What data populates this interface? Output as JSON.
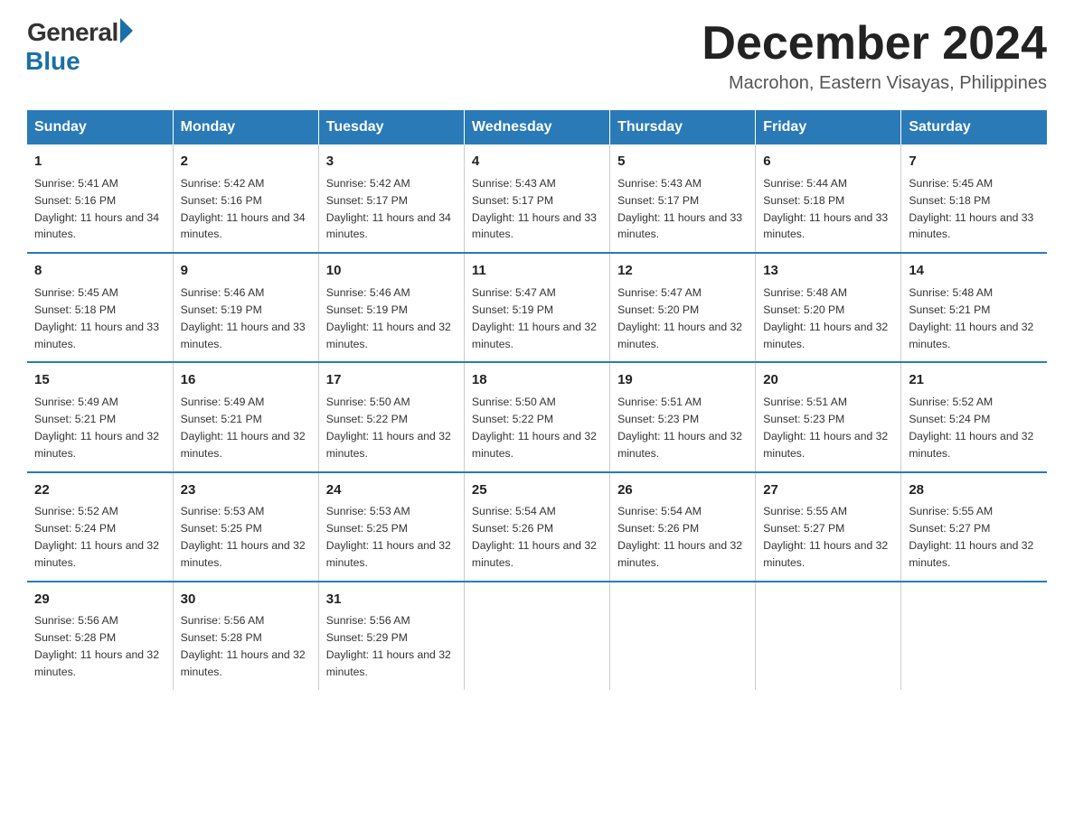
{
  "logo": {
    "general": "General",
    "blue": "Blue"
  },
  "title": "December 2024",
  "location": "Macrohon, Eastern Visayas, Philippines",
  "weekdays": [
    "Sunday",
    "Monday",
    "Tuesday",
    "Wednesday",
    "Thursday",
    "Friday",
    "Saturday"
  ],
  "weeks": [
    [
      {
        "day": "1",
        "sunrise": "Sunrise: 5:41 AM",
        "sunset": "Sunset: 5:16 PM",
        "daylight": "Daylight: 11 hours and 34 minutes."
      },
      {
        "day": "2",
        "sunrise": "Sunrise: 5:42 AM",
        "sunset": "Sunset: 5:16 PM",
        "daylight": "Daylight: 11 hours and 34 minutes."
      },
      {
        "day": "3",
        "sunrise": "Sunrise: 5:42 AM",
        "sunset": "Sunset: 5:17 PM",
        "daylight": "Daylight: 11 hours and 34 minutes."
      },
      {
        "day": "4",
        "sunrise": "Sunrise: 5:43 AM",
        "sunset": "Sunset: 5:17 PM",
        "daylight": "Daylight: 11 hours and 33 minutes."
      },
      {
        "day": "5",
        "sunrise": "Sunrise: 5:43 AM",
        "sunset": "Sunset: 5:17 PM",
        "daylight": "Daylight: 11 hours and 33 minutes."
      },
      {
        "day": "6",
        "sunrise": "Sunrise: 5:44 AM",
        "sunset": "Sunset: 5:18 PM",
        "daylight": "Daylight: 11 hours and 33 minutes."
      },
      {
        "day": "7",
        "sunrise": "Sunrise: 5:45 AM",
        "sunset": "Sunset: 5:18 PM",
        "daylight": "Daylight: 11 hours and 33 minutes."
      }
    ],
    [
      {
        "day": "8",
        "sunrise": "Sunrise: 5:45 AM",
        "sunset": "Sunset: 5:18 PM",
        "daylight": "Daylight: 11 hours and 33 minutes."
      },
      {
        "day": "9",
        "sunrise": "Sunrise: 5:46 AM",
        "sunset": "Sunset: 5:19 PM",
        "daylight": "Daylight: 11 hours and 33 minutes."
      },
      {
        "day": "10",
        "sunrise": "Sunrise: 5:46 AM",
        "sunset": "Sunset: 5:19 PM",
        "daylight": "Daylight: 11 hours and 32 minutes."
      },
      {
        "day": "11",
        "sunrise": "Sunrise: 5:47 AM",
        "sunset": "Sunset: 5:19 PM",
        "daylight": "Daylight: 11 hours and 32 minutes."
      },
      {
        "day": "12",
        "sunrise": "Sunrise: 5:47 AM",
        "sunset": "Sunset: 5:20 PM",
        "daylight": "Daylight: 11 hours and 32 minutes."
      },
      {
        "day": "13",
        "sunrise": "Sunrise: 5:48 AM",
        "sunset": "Sunset: 5:20 PM",
        "daylight": "Daylight: 11 hours and 32 minutes."
      },
      {
        "day": "14",
        "sunrise": "Sunrise: 5:48 AM",
        "sunset": "Sunset: 5:21 PM",
        "daylight": "Daylight: 11 hours and 32 minutes."
      }
    ],
    [
      {
        "day": "15",
        "sunrise": "Sunrise: 5:49 AM",
        "sunset": "Sunset: 5:21 PM",
        "daylight": "Daylight: 11 hours and 32 minutes."
      },
      {
        "day": "16",
        "sunrise": "Sunrise: 5:49 AM",
        "sunset": "Sunset: 5:21 PM",
        "daylight": "Daylight: 11 hours and 32 minutes."
      },
      {
        "day": "17",
        "sunrise": "Sunrise: 5:50 AM",
        "sunset": "Sunset: 5:22 PM",
        "daylight": "Daylight: 11 hours and 32 minutes."
      },
      {
        "day": "18",
        "sunrise": "Sunrise: 5:50 AM",
        "sunset": "Sunset: 5:22 PM",
        "daylight": "Daylight: 11 hours and 32 minutes."
      },
      {
        "day": "19",
        "sunrise": "Sunrise: 5:51 AM",
        "sunset": "Sunset: 5:23 PM",
        "daylight": "Daylight: 11 hours and 32 minutes."
      },
      {
        "day": "20",
        "sunrise": "Sunrise: 5:51 AM",
        "sunset": "Sunset: 5:23 PM",
        "daylight": "Daylight: 11 hours and 32 minutes."
      },
      {
        "day": "21",
        "sunrise": "Sunrise: 5:52 AM",
        "sunset": "Sunset: 5:24 PM",
        "daylight": "Daylight: 11 hours and 32 minutes."
      }
    ],
    [
      {
        "day": "22",
        "sunrise": "Sunrise: 5:52 AM",
        "sunset": "Sunset: 5:24 PM",
        "daylight": "Daylight: 11 hours and 32 minutes."
      },
      {
        "day": "23",
        "sunrise": "Sunrise: 5:53 AM",
        "sunset": "Sunset: 5:25 PM",
        "daylight": "Daylight: 11 hours and 32 minutes."
      },
      {
        "day": "24",
        "sunrise": "Sunrise: 5:53 AM",
        "sunset": "Sunset: 5:25 PM",
        "daylight": "Daylight: 11 hours and 32 minutes."
      },
      {
        "day": "25",
        "sunrise": "Sunrise: 5:54 AM",
        "sunset": "Sunset: 5:26 PM",
        "daylight": "Daylight: 11 hours and 32 minutes."
      },
      {
        "day": "26",
        "sunrise": "Sunrise: 5:54 AM",
        "sunset": "Sunset: 5:26 PM",
        "daylight": "Daylight: 11 hours and 32 minutes."
      },
      {
        "day": "27",
        "sunrise": "Sunrise: 5:55 AM",
        "sunset": "Sunset: 5:27 PM",
        "daylight": "Daylight: 11 hours and 32 minutes."
      },
      {
        "day": "28",
        "sunrise": "Sunrise: 5:55 AM",
        "sunset": "Sunset: 5:27 PM",
        "daylight": "Daylight: 11 hours and 32 minutes."
      }
    ],
    [
      {
        "day": "29",
        "sunrise": "Sunrise: 5:56 AM",
        "sunset": "Sunset: 5:28 PM",
        "daylight": "Daylight: 11 hours and 32 minutes."
      },
      {
        "day": "30",
        "sunrise": "Sunrise: 5:56 AM",
        "sunset": "Sunset: 5:28 PM",
        "daylight": "Daylight: 11 hours and 32 minutes."
      },
      {
        "day": "31",
        "sunrise": "Sunrise: 5:56 AM",
        "sunset": "Sunset: 5:29 PM",
        "daylight": "Daylight: 11 hours and 32 minutes."
      },
      null,
      null,
      null,
      null
    ]
  ]
}
